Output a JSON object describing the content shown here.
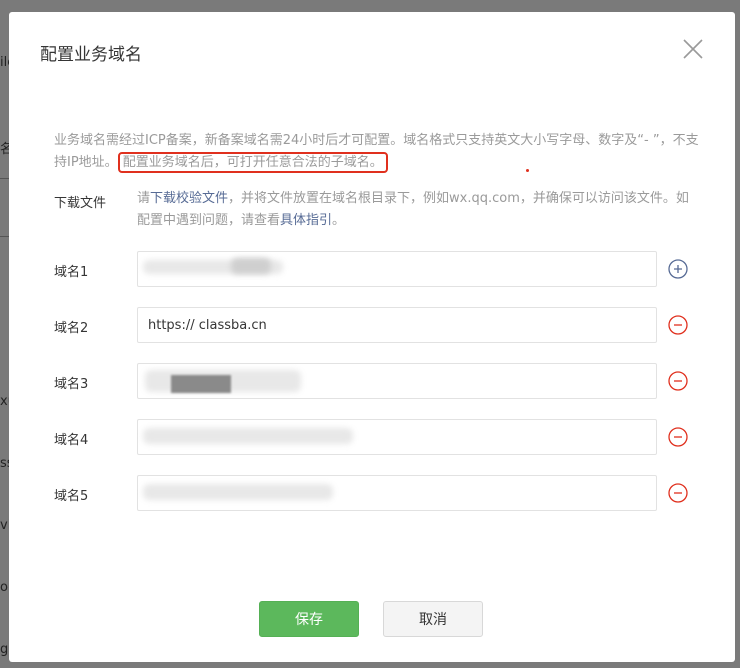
{
  "dialog": {
    "title": "配置业务域名",
    "notice_prefix": "业务域名需经过ICP备案，新备案域名需24小时后才可配置。域名格式只支持英文大小写字母、数字及“- ”，不支持IP地址。",
    "notice_highlight": "配置业务域名后，可打开任意合法的子域名。"
  },
  "download": {
    "label": "下载文件",
    "text_1": "请",
    "link_1": "下载校验文件",
    "text_2": "，并将文件放置在域名根目录下，例如wx.qq.com，并确保可以访问该文件。如配置中遇到问题，请查看",
    "link_2": "具体指引",
    "text_3": "。"
  },
  "domains": [
    {
      "label": "域名1",
      "value": "",
      "action": "add-circle-icon"
    },
    {
      "label": "域名2",
      "value": "https:// classba.cn",
      "action": "remove-circle-icon"
    },
    {
      "label": "域名3",
      "value": "",
      "action": "remove-circle-icon"
    },
    {
      "label": "域名4",
      "value": "",
      "action": "remove-circle-icon"
    },
    {
      "label": "域名5",
      "value": "",
      "action": "remove-circle-icon"
    }
  ],
  "buttons": {
    "save": "保存",
    "cancel": "取消"
  },
  "background_fragments": [
    "ile",
    "名",
    "xu",
    "ss",
    "vi:",
    "o(",
    "g"
  ],
  "colors": {
    "primary_green": "#5cb85c",
    "link_blue": "#576b95",
    "add_icon_blue": "#576b95",
    "remove_icon_red": "#e0301e",
    "highlight_red": "#e0301e"
  }
}
